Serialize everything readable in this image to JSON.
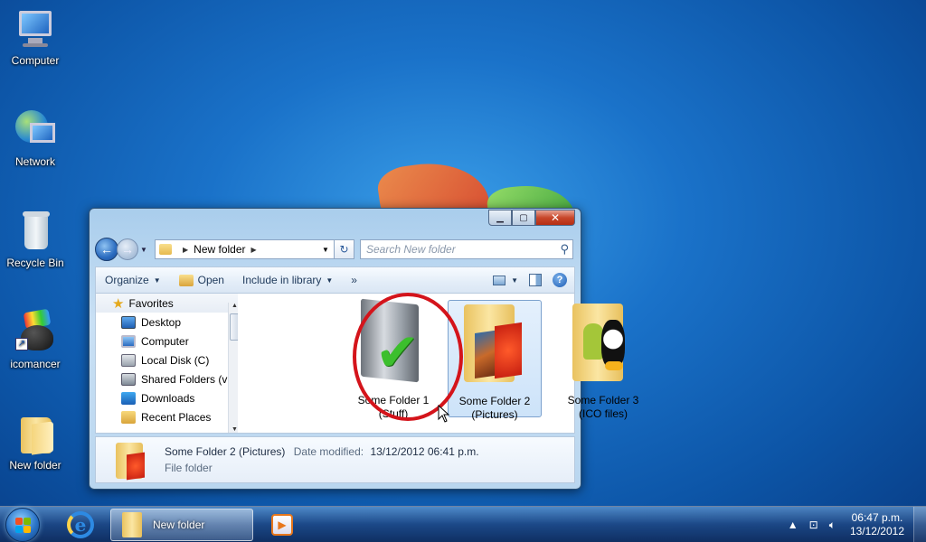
{
  "desktop": {
    "icons": [
      {
        "label": "Computer"
      },
      {
        "label": "Network"
      },
      {
        "label": "Recycle Bin"
      },
      {
        "label": "icomancer"
      },
      {
        "label": "New folder"
      }
    ]
  },
  "window": {
    "breadcrumb": {
      "item": "New folder"
    },
    "search": {
      "placeholder": "Search New folder"
    },
    "toolbar": {
      "organize": "Organize",
      "open": "Open",
      "include": "Include in library",
      "more": "»"
    },
    "nav": {
      "favorites": "Favorites",
      "items": [
        "Desktop",
        "Computer",
        "Local Disk (C)",
        "Shared Folders (v",
        "Downloads",
        "Recent Places"
      ]
    },
    "files": [
      {
        "line1": "Some Folder 1",
        "line2": "(Stuff)"
      },
      {
        "line1": "Some Folder 2",
        "line2": "(Pictures)"
      },
      {
        "line1": "Some Folder 3",
        "line2": "(ICO files)"
      }
    ],
    "details": {
      "name": "Some Folder 2 (Pictures)",
      "date_label": "Date modified:",
      "date": "13/12/2012 06:41 p.m.",
      "type": "File folder"
    }
  },
  "taskbar": {
    "active_label": "New folder",
    "time": "06:47 p.m.",
    "date": "13/12/2012"
  }
}
